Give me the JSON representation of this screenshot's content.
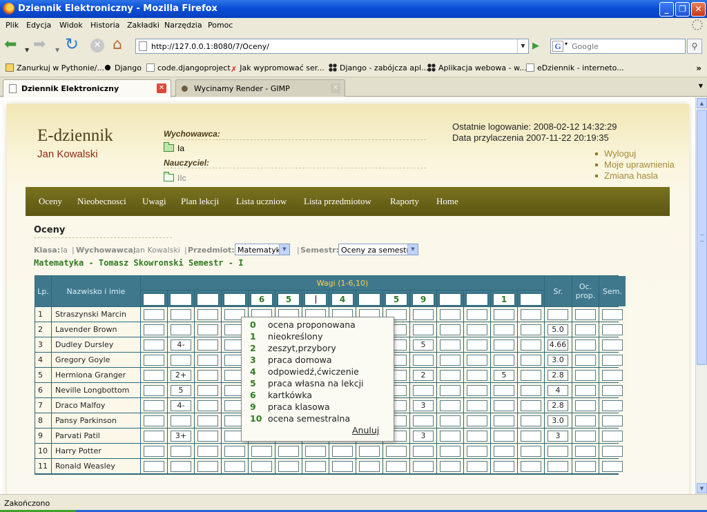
{
  "window": {
    "title": "Dziennik Elektroniczny - Mozilla Firefox"
  },
  "menu": [
    "Plik",
    "Edycja",
    "Widok",
    "Historia",
    "Zakładki",
    "Narzędzia",
    "Pomoc"
  ],
  "urlbar": {
    "url": "http://127.0.0.1:8080/7/Oceny/"
  },
  "search": {
    "placeholder": "Google"
  },
  "bookmarks": [
    {
      "label": "Zanurkuj w Pythonie/...",
      "icon": "bookmark-star-icon"
    },
    {
      "label": "Django",
      "icon": "tux-icon"
    },
    {
      "label": "code.djangoproject",
      "icon": "page-icon"
    },
    {
      "label": "Jak wypromować ser...",
      "icon": "red-figure-icon"
    },
    {
      "label": "Django - zabójcza apl...",
      "icon": "dots-icon"
    },
    {
      "label": "Aplikacja webowa - w...",
      "icon": "dots-icon"
    },
    {
      "label": "eDziennik - interneto...",
      "icon": "page-icon"
    }
  ],
  "tabs": [
    {
      "label": "Dziennik Elektroniczny",
      "active": true
    },
    {
      "label": "Wycinamy Render - GIMP",
      "active": false
    }
  ],
  "header": {
    "brand": "E-dziennik",
    "user": "Jan Kowalski",
    "wychowawca_label": "Wychowawca:",
    "wychowawca_class": "Ia",
    "nauczyciel_label": "Nauczyciel:",
    "nauczyciel_class": "IIc",
    "last_login": "Ostatnie logowanie: 2008-02-12 14:32:29",
    "joined": "Data przylaczenia 2007-11-22 20:19:35",
    "links": [
      "Wyloguj",
      "Moje uprawnienia",
      "Zmiana hasla"
    ]
  },
  "nav": [
    "Oceny",
    "Nieobecnosci",
    "Uwagi",
    "Plan lekcji",
    "Lista uczniow",
    "Lista przedmiotow",
    "Raporty",
    "Home"
  ],
  "section": {
    "title": "Oceny"
  },
  "filters": {
    "klasa_label": "Klasa:",
    "klasa_value": "Ia",
    "wych_label": "Wychowawca:",
    "wych_value": "Jan Kowalski",
    "przedmiot_label": "Przedmiot:",
    "przedmiot_value": "Matematyka",
    "semestr_label": "Semestr:",
    "semestr_value": "Oceny za semestr I",
    "sep": "|"
  },
  "subject_line": "Matematyka - Tomasz Skowronski Semestr - I",
  "table": {
    "col_lp": "Lp.",
    "col_name": "Nazwisko i imie",
    "col_weights": "Wagi (1-6,10)",
    "col_avg": "Sr.",
    "col_prop": "Oc. prop.",
    "col_sem": "Sem.",
    "weights": [
      "",
      "",
      "",
      "",
      "6",
      "5",
      "",
      "4",
      "",
      "5",
      "9",
      "",
      "",
      "1",
      ""
    ],
    "students": [
      {
        "lp": "1",
        "name": "Straszynski Marcin",
        "grades": [
          "",
          "",
          "",
          "",
          "",
          "",
          "",
          "",
          "",
          "",
          "",
          "",
          "",
          "",
          ""
        ],
        "avg": "",
        "prop": "",
        "sem": ""
      },
      {
        "lp": "2",
        "name": "Lavender Brown",
        "grades": [
          "",
          "",
          "",
          "",
          "",
          "",
          "",
          "",
          "",
          "",
          "",
          "",
          "",
          "",
          ""
        ],
        "avg": "5.0",
        "prop": "",
        "sem": ""
      },
      {
        "lp": "3",
        "name": "Dudley Dursley",
        "grades": [
          "",
          "4-",
          "",
          "",
          "",
          "",
          "",
          "",
          "",
          "",
          "5",
          "",
          "",
          "",
          ""
        ],
        "avg": "4.66",
        "prop": "",
        "sem": ""
      },
      {
        "lp": "4",
        "name": "Gregory Goyle",
        "grades": [
          "",
          "",
          "",
          "",
          "",
          "",
          "",
          "",
          "",
          "",
          "",
          "",
          "",
          "",
          ""
        ],
        "avg": "3.0",
        "prop": "",
        "sem": ""
      },
      {
        "lp": "5",
        "name": "Hermiona Granger",
        "grades": [
          "",
          "2+",
          "",
          "",
          "",
          "",
          "",
          "",
          "",
          "",
          "2",
          "",
          "",
          "5",
          ""
        ],
        "avg": "2.8",
        "prop": "",
        "sem": ""
      },
      {
        "lp": "6",
        "name": "Neville Longbottom",
        "grades": [
          "",
          "5",
          "",
          "",
          "",
          "",
          "",
          "",
          "",
          "",
          "",
          "",
          "",
          "",
          ""
        ],
        "avg": "4",
        "prop": "",
        "sem": ""
      },
      {
        "lp": "7",
        "name": "Draco Malfoy",
        "grades": [
          "",
          "4-",
          "",
          "",
          "",
          "",
          "",
          "",
          "",
          "",
          "3",
          "",
          "",
          "",
          ""
        ],
        "avg": "2.8",
        "prop": "",
        "sem": ""
      },
      {
        "lp": "8",
        "name": "Pansy Parkinson",
        "grades": [
          "",
          "",
          "",
          "",
          "",
          "",
          "",
          "",
          "",
          "",
          "",
          "",
          "",
          "",
          ""
        ],
        "avg": "3.0",
        "prop": "",
        "sem": ""
      },
      {
        "lp": "9",
        "name": "Parvati Patil",
        "grades": [
          "",
          "3+",
          "",
          "",
          "",
          "",
          "",
          "",
          "",
          "",
          "3",
          "",
          "",
          "",
          ""
        ],
        "avg": "3",
        "prop": "",
        "sem": ""
      },
      {
        "lp": "10",
        "name": "Harry Potter",
        "grades": [
          "",
          "",
          "",
          "",
          "",
          "",
          "",
          "",
          "",
          "",
          "",
          "",
          "",
          "",
          ""
        ],
        "avg": "",
        "prop": "",
        "sem": ""
      },
      {
        "lp": "11",
        "name": "Ronald Weasley",
        "grades": [
          "",
          "",
          "",
          "",
          "",
          "",
          "",
          "",
          "",
          "",
          "",
          "",
          "",
          "",
          ""
        ],
        "avg": "",
        "prop": "",
        "sem": ""
      }
    ]
  },
  "popup": {
    "options": [
      {
        "code": "0",
        "label": "ocena proponowana"
      },
      {
        "code": "1",
        "label": "nieokreślony"
      },
      {
        "code": "2",
        "label": "zeszyt,przybory"
      },
      {
        "code": "3",
        "label": "praca domowa"
      },
      {
        "code": "4",
        "label": "odpowiedź,ćwiczenie"
      },
      {
        "code": "5",
        "label": "praca własna na lekcji"
      },
      {
        "code": "6",
        "label": "kartkówka"
      },
      {
        "code": "9",
        "label": "praca klasowa"
      },
      {
        "code": "10",
        "label": "ocena semestralna"
      }
    ],
    "cancel": "Anuluj"
  },
  "status": {
    "text": "Zakończono"
  },
  "colors": {
    "nav": "#6b6418",
    "table_header": "#3f788c",
    "accent_green": "#2f7a22",
    "user_name": "#8e2a14"
  }
}
